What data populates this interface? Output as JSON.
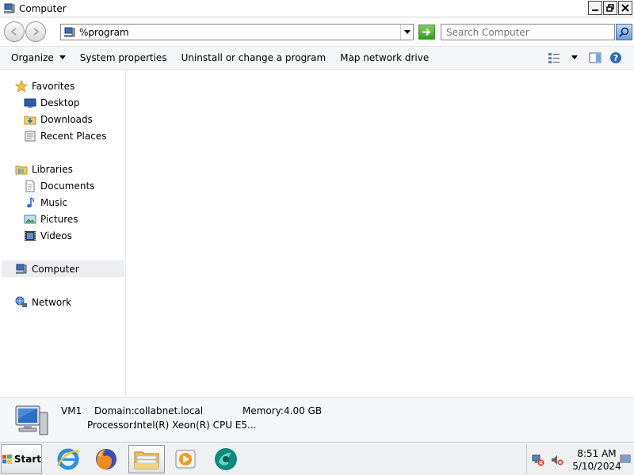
{
  "window": {
    "title": "Computer"
  },
  "address": {
    "value": "%program"
  },
  "search": {
    "placeholder": "Search Computer"
  },
  "commands": [
    {
      "label": "Organize"
    },
    {
      "label": "System properties"
    },
    {
      "label": "Uninstall or change a program"
    },
    {
      "label": "Map network drive"
    }
  ],
  "nav": {
    "favorites": "Favorites",
    "desktop": "Desktop",
    "downloads": "Downloads",
    "recent": "Recent Places",
    "libraries": "Libraries",
    "documents": "Documents",
    "music": "Music",
    "pictures": "Pictures",
    "videos": "Videos",
    "computer": "Computer",
    "network": "Network"
  },
  "details": {
    "name": "VM1",
    "domain_label": "Domain:",
    "domain": "collabnet.local",
    "memory_label": "Memory:",
    "memory": "4.00 GB",
    "processor_label": "Processor:",
    "processor": "Intel(R) Xeon(R) CPU E5..."
  },
  "taskbar": {
    "start": "Start",
    "time": "8:51 AM",
    "date": "5/10/2024"
  },
  "colors": {
    "selected_bg": "#eceef1",
    "go_green": "#2f9d1c"
  }
}
